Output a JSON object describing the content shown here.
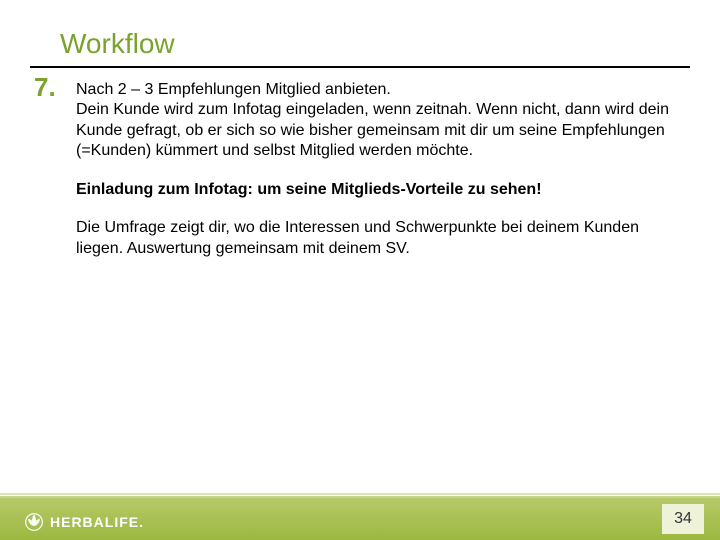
{
  "title": "Workflow",
  "list_number": "7.",
  "lead": "Nach 2 – 3 Empfehlungen Mitglied anbieten.",
  "para1": "Dein Kunde wird zum Infotag eingeladen, wenn zeitnah. Wenn nicht, dann wird dein Kunde gefragt, ob er sich so wie bisher gemeinsam mit dir um seine Empfehlungen (=Kunden) kümmert und selbst Mitglied werden möchte.",
  "bold_line": "Einladung zum Infotag: um seine Mitglieds-Vorteile zu sehen!",
  "para2": "Die Umfrage zeigt dir, wo die Interessen und Schwerpunkte bei deinem Kunden liegen. Auswertung gemeinsam mit deinem SV.",
  "brand": "HERBALIFE",
  "page_number": "34",
  "colors": {
    "accent": "#7aa22f",
    "footer_gradient_top": "#b7c96a",
    "footer_gradient_bottom": "#9cb83f",
    "page_box_bg": "#eef2d9"
  }
}
